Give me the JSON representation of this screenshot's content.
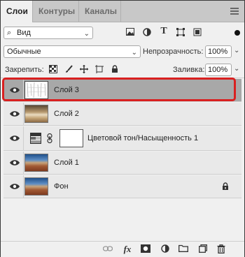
{
  "tabs": [
    {
      "label": "Слои",
      "active": true
    },
    {
      "label": "Контуры",
      "active": false
    },
    {
      "label": "Каналы",
      "active": false
    }
  ],
  "filter": {
    "kind_label": "Вид"
  },
  "blend": {
    "mode": "Обычные",
    "opacity_label": "Непрозрачность:",
    "opacity_value": "100%"
  },
  "lock": {
    "label": "Закрепить:",
    "fill_label": "Заливка:",
    "fill_value": "100%"
  },
  "layers": [
    {
      "name": "Слой 3",
      "selected": true,
      "thumb": "texture"
    },
    {
      "name": "Слой 2",
      "selected": false,
      "thumb": "sepia"
    },
    {
      "name": "Цветовой тон/Насыщенность 1",
      "selected": false,
      "thumb": "adjustment"
    },
    {
      "name": "Слой 1",
      "selected": false,
      "thumb": "landscape"
    },
    {
      "name": "Фон",
      "selected": false,
      "thumb": "landscape",
      "locked": true
    }
  ],
  "icons": {
    "search": "search-icon",
    "filter_types": [
      "image-filter-icon",
      "adjustment-filter-icon",
      "type-filter-icon",
      "shape-filter-icon",
      "smart-object-filter-icon"
    ],
    "lock_types": [
      "lock-transparent-icon",
      "lock-paint-icon",
      "lock-position-icon",
      "lock-artboard-icon",
      "lock-all-icon"
    ],
    "bottom": [
      "link-icon",
      "fx-icon",
      "add-mask-icon",
      "adjustment-layer-icon",
      "new-group-icon",
      "new-layer-icon",
      "trash-icon"
    ]
  },
  "colors": {
    "selection_outline": "#d92020",
    "selected_row": "#a8a8a8"
  }
}
